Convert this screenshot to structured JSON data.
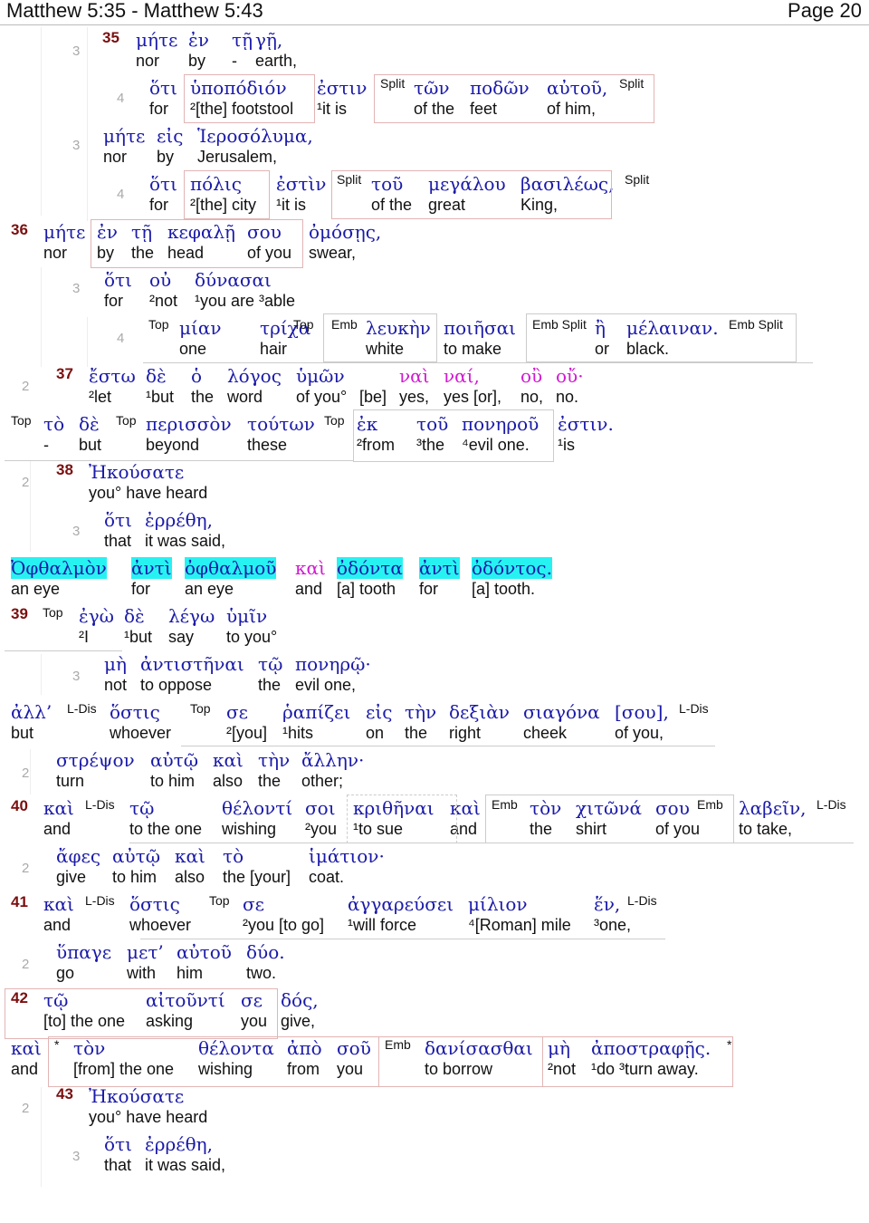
{
  "header": {
    "title": "Matthew 5:35 - Matthew 5:43",
    "page": "Page 20"
  },
  "tags": {
    "split": "Split",
    "top": "Top",
    "emb": "Emb",
    "emb_split": "Emb Split",
    "ldis": "L-Dis",
    "star": "*"
  },
  "lines": [
    {
      "num": "3",
      "verse": "35",
      "words": [
        [
          "μήτε",
          "nor"
        ],
        [
          "ἐν",
          "by"
        ],
        [
          "τῇ",
          "-"
        ],
        [
          "γῇ,",
          "earth,"
        ]
      ]
    },
    {
      "num": "4",
      "words": [
        [
          "ὅτι",
          "for"
        ],
        [
          "ὑποπόδιόν",
          "²[the] footstool"
        ],
        [
          "ἐστιν",
          "¹it is"
        ],
        [
          "τῶν",
          "of the"
        ],
        [
          "ποδῶν",
          "feet"
        ],
        [
          "αὐτοῦ,",
          "of him,"
        ]
      ]
    },
    {
      "num": "3",
      "words": [
        [
          "μήτε",
          "nor"
        ],
        [
          "εἰς",
          "by"
        ],
        [
          "Ἱεροσόλυμα,",
          "Jerusalem,"
        ]
      ]
    },
    {
      "num": "4",
      "words": [
        [
          "ὅτι",
          "for"
        ],
        [
          "πόλις",
          "²[the] city"
        ],
        [
          "ἐστὶν",
          "¹it is"
        ],
        [
          "τοῦ",
          "of the"
        ],
        [
          "μεγάλου",
          "great"
        ],
        [
          "βασιλέως,",
          "King,"
        ]
      ]
    },
    {
      "verse": "36",
      "words": [
        [
          "μήτε",
          "nor"
        ],
        [
          "ἐν",
          "by"
        ],
        [
          "τῇ",
          "the"
        ],
        [
          "κεφαλῇ",
          "head"
        ],
        [
          "σου",
          "of you"
        ],
        [
          "ὀμόσῃς,",
          "swear,"
        ]
      ]
    },
    {
      "num": "3",
      "words": [
        [
          "ὅτι",
          "for"
        ],
        [
          "οὐ",
          "²not"
        ],
        [
          "δύνασαι",
          "¹you are ³able"
        ]
      ]
    },
    {
      "num": "4",
      "words": [
        [
          "μίαν",
          "one"
        ],
        [
          "τρίχα",
          "hair"
        ],
        [
          "λευκὴν",
          "white"
        ],
        [
          "ποιῆσαι",
          "to make"
        ],
        [
          "ἢ",
          "or"
        ],
        [
          "μέλαιναν.",
          "black."
        ]
      ]
    },
    {
      "num": "2",
      "verse": "37",
      "words": [
        [
          "ἔστω",
          "²let"
        ],
        [
          "δὲ",
          "¹but"
        ],
        [
          "ὁ",
          "the"
        ],
        [
          "λόγος",
          "word"
        ],
        [
          "ὑμῶν",
          "of you°"
        ],
        [
          "",
          "[be]"
        ],
        [
          "ναὶ",
          "yes,"
        ],
        [
          "ναί,",
          "yes [or],"
        ],
        [
          "οὒ",
          "no,"
        ],
        [
          "οὔ·",
          "no."
        ]
      ]
    },
    {
      "words": [
        [
          "τὸ",
          "-"
        ],
        [
          "δὲ",
          "but"
        ],
        [
          "περισσὸν",
          "beyond"
        ],
        [
          "τούτων",
          "these"
        ],
        [
          "ἐκ",
          "²from"
        ],
        [
          "τοῦ",
          "³the"
        ],
        [
          "πονηροῦ",
          "⁴evil one."
        ],
        [
          "ἐστιν.",
          "¹is"
        ]
      ]
    },
    {
      "num": "2",
      "verse": "38",
      "words": [
        [
          "Ἠκούσατε",
          "you° have heard"
        ]
      ]
    },
    {
      "num": "3",
      "words": [
        [
          "ὅτι",
          "that"
        ],
        [
          "ἐρρέθη,",
          "it was said,"
        ]
      ]
    },
    {
      "words": [
        [
          "Ὀφθαλμὸν",
          "an eye"
        ],
        [
          "ἀντὶ",
          "for"
        ],
        [
          "ὀφθαλμοῦ",
          "an eye"
        ],
        [
          "καὶ",
          "and"
        ],
        [
          "ὀδόντα",
          "[a] tooth"
        ],
        [
          "ἀντὶ",
          "for"
        ],
        [
          "ὀδόντος.",
          "[a] tooth."
        ]
      ]
    },
    {
      "verse": "39",
      "words": [
        [
          "ἐγὼ",
          "²I"
        ],
        [
          "δὲ",
          "¹but"
        ],
        [
          "λέγω",
          "say"
        ],
        [
          "ὑμῖν",
          "to you°"
        ]
      ]
    },
    {
      "num": "3",
      "words": [
        [
          "μὴ",
          "not"
        ],
        [
          "ἀντιστῆναι",
          "to oppose"
        ],
        [
          "τῷ",
          "the"
        ],
        [
          "πονηρῷ·",
          "evil one,"
        ]
      ]
    },
    {
      "words": [
        [
          "ἀλλ’",
          "but"
        ],
        [
          "ὅστις",
          "whoever"
        ],
        [
          "σε",
          "²[you]"
        ],
        [
          "ῥαπίζει",
          "¹hits"
        ],
        [
          "εἰς",
          "on"
        ],
        [
          "τὴν",
          "the"
        ],
        [
          "δεξιὰν",
          "right"
        ],
        [
          "σιαγόνα",
          "cheek"
        ],
        [
          "[σου],",
          "of you,"
        ]
      ]
    },
    {
      "num": "2",
      "words": [
        [
          "στρέψον",
          "turn"
        ],
        [
          "αὐτῷ",
          "to him"
        ],
        [
          "καὶ",
          "also"
        ],
        [
          "τὴν",
          "the"
        ],
        [
          "ἄλλην·",
          "other;"
        ]
      ]
    },
    {
      "verse": "40",
      "words": [
        [
          "καὶ",
          "and"
        ],
        [
          "τῷ",
          "to the one"
        ],
        [
          "θέλοντί",
          "wishing"
        ],
        [
          "σοι",
          "²you"
        ],
        [
          "κριθῆναι",
          "¹to sue"
        ],
        [
          "καὶ",
          "and"
        ],
        [
          "τὸν",
          "the"
        ],
        [
          "χιτῶνά",
          "shirt"
        ],
        [
          "σου",
          "of you"
        ],
        [
          "λαβεῖν,",
          "to take,"
        ]
      ]
    },
    {
      "num": "2",
      "words": [
        [
          "ἄφες",
          "give"
        ],
        [
          "αὐτῷ",
          "to him"
        ],
        [
          "καὶ",
          "also"
        ],
        [
          "τὸ",
          "the [your]"
        ],
        [
          "ἱμάτιον·",
          "coat."
        ]
      ]
    },
    {
      "verse": "41",
      "words": [
        [
          "καὶ",
          "and"
        ],
        [
          "ὅστις",
          "whoever"
        ],
        [
          "σε",
          "²you [to go]"
        ],
        [
          "ἀγγαρεύσει",
          "¹will force"
        ],
        [
          "μίλιον",
          "⁴[Roman] mile"
        ],
        [
          "ἕν,",
          "³one,"
        ]
      ]
    },
    {
      "num": "2",
      "words": [
        [
          "ὕπαγε",
          "go"
        ],
        [
          "μετ’",
          "with"
        ],
        [
          "αὐτοῦ",
          "him"
        ],
        [
          "δύο.",
          "two."
        ]
      ]
    },
    {
      "verse": "42",
      "words": [
        [
          "τῷ",
          "[to] the one"
        ],
        [
          "αἰτοῦντί",
          "asking"
        ],
        [
          "σε",
          "you"
        ],
        [
          "δός,",
          "give,"
        ]
      ]
    },
    {
      "words": [
        [
          "καὶ",
          "and"
        ],
        [
          "τὸν",
          "[from] the one"
        ],
        [
          "θέλοντα",
          "wishing"
        ],
        [
          "ἀπὸ",
          "from"
        ],
        [
          "σοῦ",
          "you"
        ],
        [
          "δανίσασθαι",
          "to borrow"
        ],
        [
          "μὴ",
          "²not"
        ],
        [
          "ἀποστραφῇς.",
          "¹do ³turn away."
        ]
      ]
    },
    {
      "num": "2",
      "verse": "43",
      "words": [
        [
          "Ἠκούσατε",
          "you° have heard"
        ]
      ]
    },
    {
      "num": "3",
      "words": [
        [
          "ὅτι",
          "that"
        ],
        [
          "ἐρρέθη,",
          "it was said,"
        ]
      ]
    }
  ]
}
